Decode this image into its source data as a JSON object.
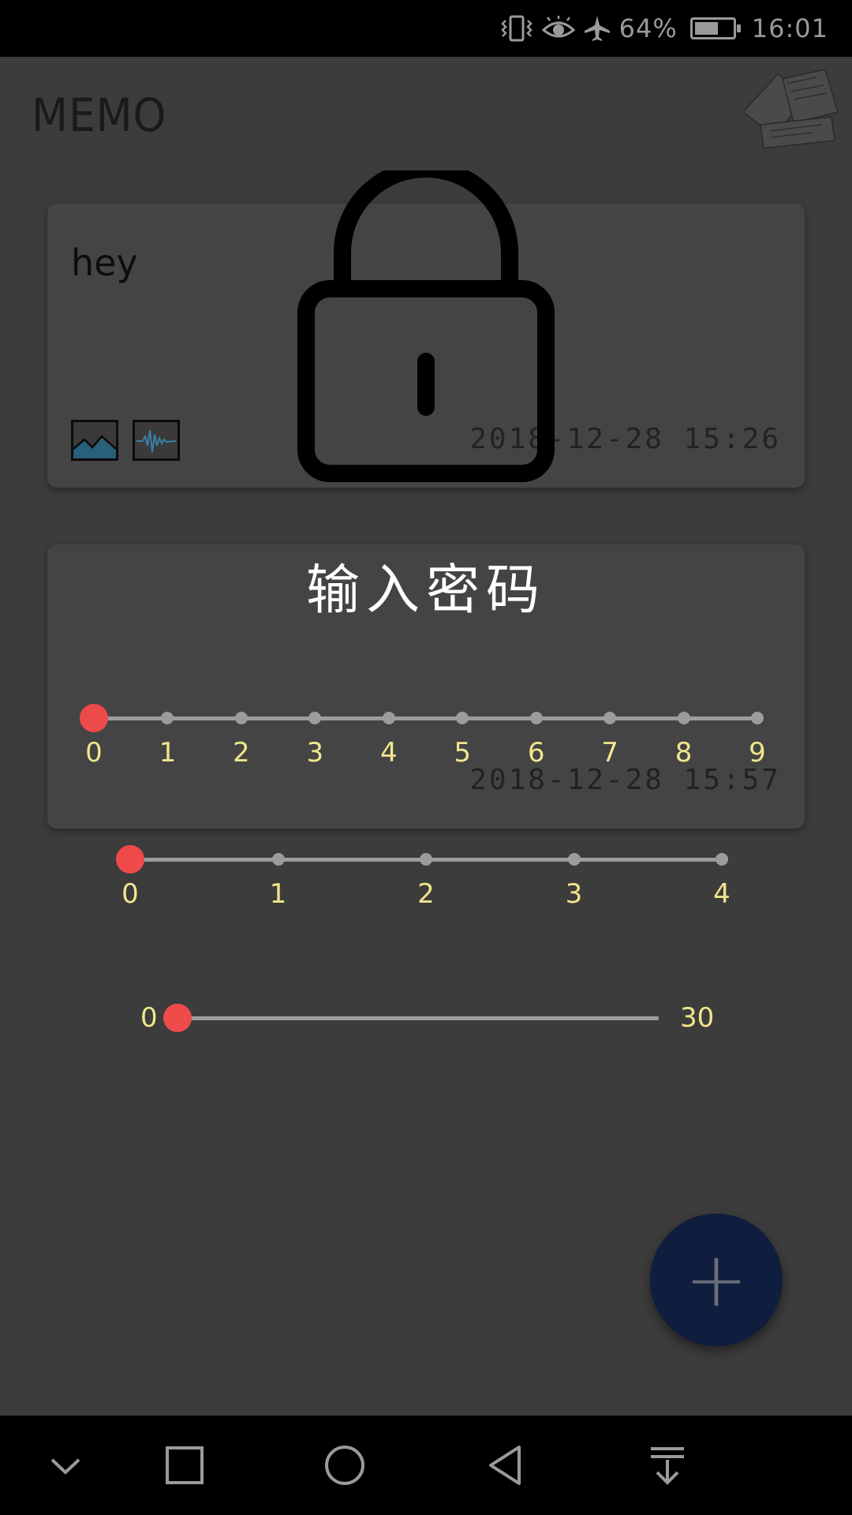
{
  "status_bar": {
    "battery_text": "64%",
    "battery_level": 0.64,
    "time": "16:01",
    "icons": [
      "vibrate-icon",
      "eye-icon",
      "airplane-icon",
      "battery-icon"
    ]
  },
  "app": {
    "title": "MEMO"
  },
  "memos": [
    {
      "text": "hey",
      "date": "2018-12-28 15:26",
      "attachments": [
        "image-icon",
        "audio-wave-icon"
      ]
    },
    {
      "text": "",
      "date": "2018-12-28 15:57"
    }
  ],
  "password_dialog": {
    "title": "输入密码",
    "slider_1": {
      "ticks": [
        "0",
        "1",
        "2",
        "3",
        "4",
        "5",
        "6",
        "7",
        "8",
        "9"
      ],
      "value": 0
    },
    "slider_2": {
      "ticks": [
        "0",
        "1",
        "2",
        "3",
        "4"
      ],
      "value": 0
    },
    "slider_3": {
      "min_label": "0",
      "max_label": "30",
      "value": 0
    }
  },
  "fab": {
    "label": "+"
  },
  "nav_bar": {
    "buttons": [
      "chevron-down-icon",
      "recent-apps-icon",
      "home-icon",
      "back-icon",
      "notification-pull-icon"
    ]
  },
  "colors": {
    "background": "#3c3c3c",
    "card": "#444444",
    "thumb": "#ef4a4a",
    "tick_label": "#f0e68c",
    "fab": "#0f1d3f"
  }
}
